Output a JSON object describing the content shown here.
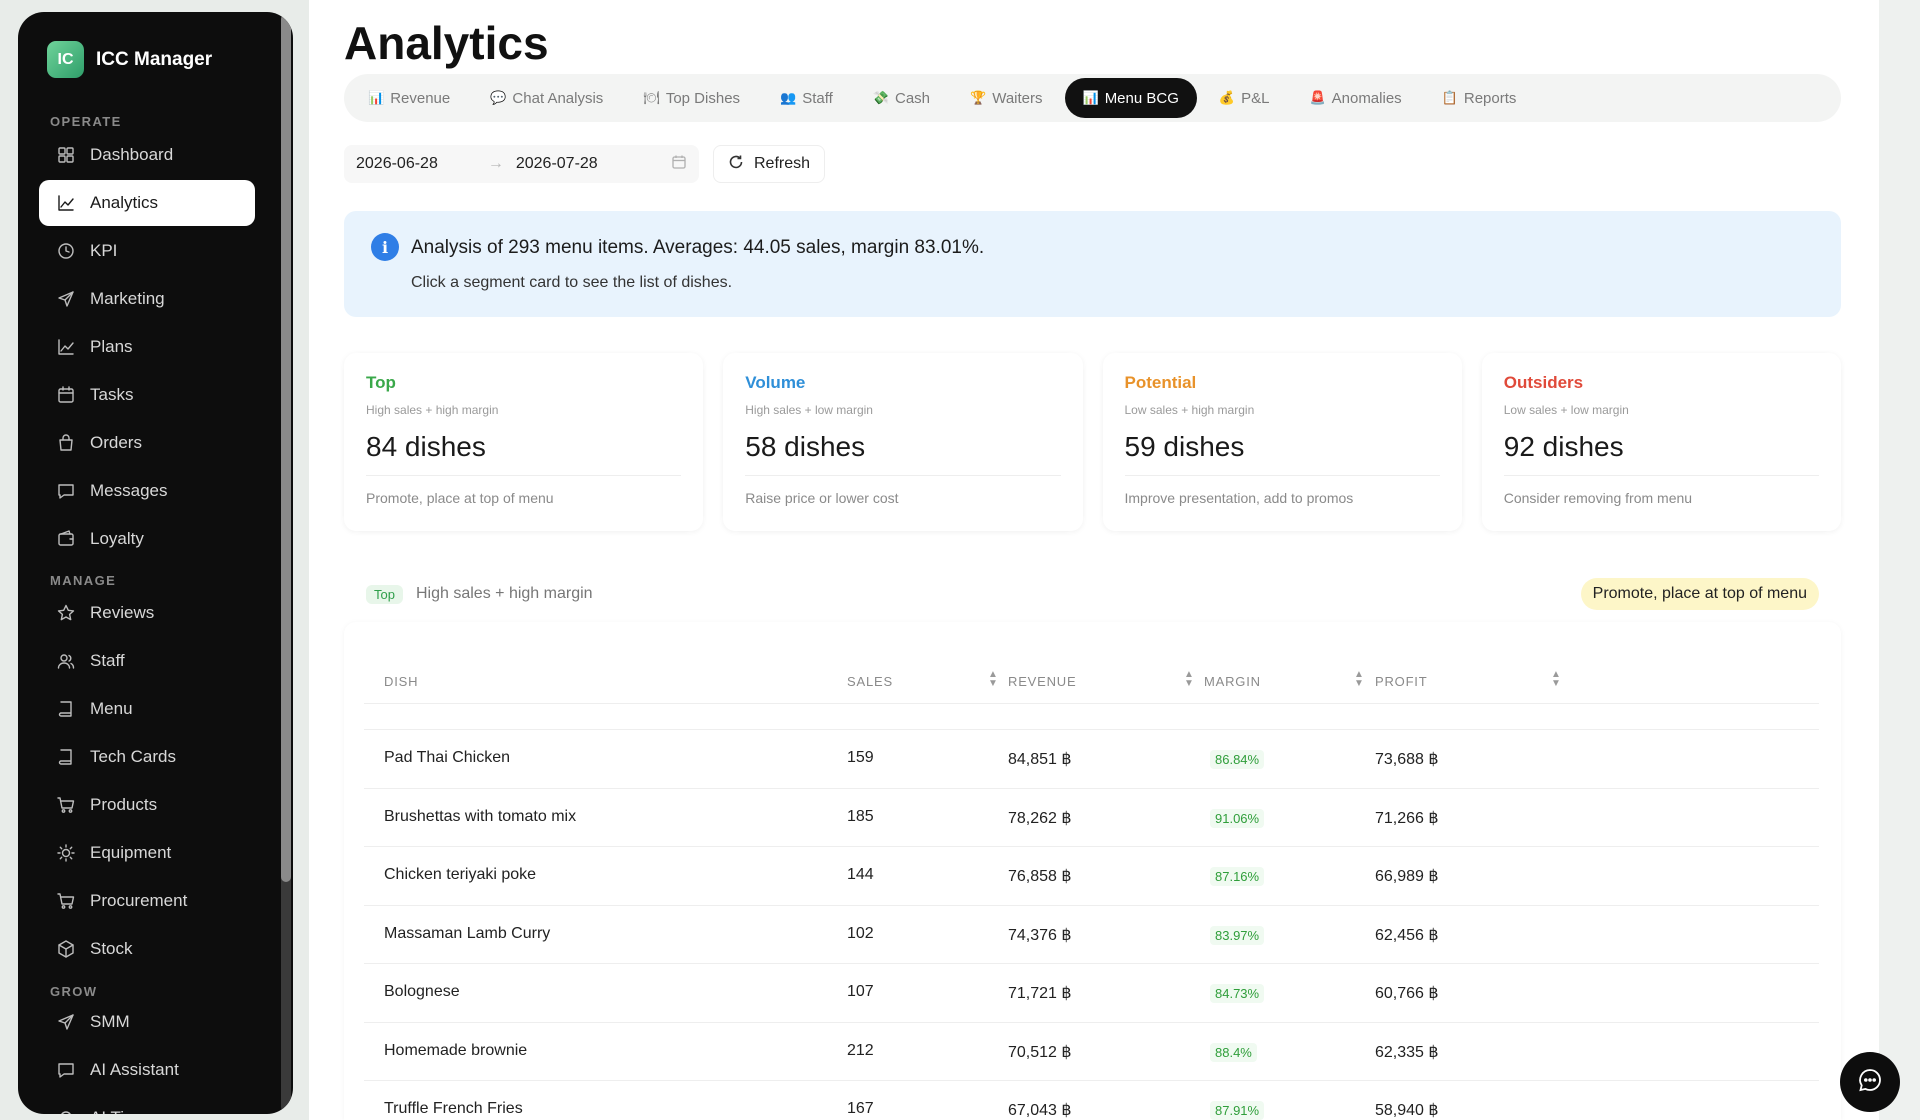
{
  "brand": {
    "name": "ICC Manager",
    "logo": "IC"
  },
  "sidebar": {
    "sections": [
      {
        "label": "OPERATE"
      },
      {
        "label": "MANAGE"
      },
      {
        "label": "GROW"
      }
    ],
    "items": [
      {
        "label": "Dashboard",
        "icon": "grid-icon"
      },
      {
        "label": "Analytics",
        "icon": "chart-line-icon",
        "active": true
      },
      {
        "label": "KPI",
        "icon": "clock-icon"
      },
      {
        "label": "Marketing",
        "icon": "send-icon"
      },
      {
        "label": "Plans",
        "icon": "chart-line-icon"
      },
      {
        "label": "Tasks",
        "icon": "calendar-icon"
      },
      {
        "label": "Orders",
        "icon": "bag-icon"
      },
      {
        "label": "Messages",
        "icon": "message-icon"
      },
      {
        "label": "Loyalty",
        "icon": "wallet-icon"
      },
      {
        "label": "Reviews",
        "icon": "star-icon"
      },
      {
        "label": "Staff",
        "icon": "users-icon"
      },
      {
        "label": "Menu",
        "icon": "book-icon"
      },
      {
        "label": "Tech Cards",
        "icon": "book-icon"
      },
      {
        "label": "Products",
        "icon": "cart-icon"
      },
      {
        "label": "Equipment",
        "icon": "sun-icon"
      },
      {
        "label": "Procurement",
        "icon": "cart-icon"
      },
      {
        "label": "Stock",
        "icon": "box-icon"
      },
      {
        "label": "SMM",
        "icon": "send-icon"
      },
      {
        "label": "AI Assistant",
        "icon": "message-icon"
      },
      {
        "label": "AI Tips",
        "icon": "bulb-icon"
      }
    ]
  },
  "page": {
    "title": "Analytics"
  },
  "tabs": [
    {
      "label": "Revenue",
      "emoji": "📊"
    },
    {
      "label": "Chat Analysis",
      "emoji": "💬"
    },
    {
      "label": "Top Dishes",
      "emoji": "🍽"
    },
    {
      "label": "Staff",
      "emoji": "👥"
    },
    {
      "label": "Cash",
      "emoji": "💸"
    },
    {
      "label": "Waiters",
      "emoji": "🏆"
    },
    {
      "label": "Menu BCG",
      "emoji": "📊",
      "active": true
    },
    {
      "label": "P&L",
      "emoji": "💰"
    },
    {
      "label": "Anomalies",
      "emoji": "🚨"
    },
    {
      "label": "Reports",
      "emoji": "📋"
    }
  ],
  "filters": {
    "date_from": "2026-06-28",
    "date_to": "2026-07-28",
    "arrow": "→",
    "refresh_label": "Refresh"
  },
  "info": {
    "main": "Analysis of 293 menu items. Averages: 44.05 sales, margin 83.01%.",
    "sub": "Click a segment card to see the list of dishes."
  },
  "segments": [
    {
      "title": "Top",
      "desc": "High sales + high margin",
      "count": "84 dishes",
      "action": "Promote, place at top of menu",
      "color": "#3aa84a"
    },
    {
      "title": "Volume",
      "desc": "High sales + low margin",
      "count": "58 dishes",
      "action": "Raise price or lower cost",
      "color": "#2f8fd8"
    },
    {
      "title": "Potential",
      "desc": "Low sales + high margin",
      "count": "59 dishes",
      "action": "Improve presentation, add to promos",
      "color": "#e8922a"
    },
    {
      "title": "Outsiders",
      "desc": "Low sales + low margin",
      "count": "92 dishes",
      "action": "Consider removing from menu",
      "color": "#e04a3a"
    }
  ],
  "selected_segment": {
    "badge": "Top",
    "desc": "High sales + high margin",
    "action": "Promote, place at top of menu"
  },
  "table": {
    "columns": [
      "DISH",
      "SALES",
      "REVENUE",
      "MARGIN",
      "PROFIT"
    ],
    "rows": [
      {
        "dish": "Pad Thai Chicken",
        "sales": "159",
        "revenue": "84,851 ฿",
        "margin": "86.84%",
        "profit": "73,688 ฿"
      },
      {
        "dish": "Brushettas with tomato mix",
        "sales": "185",
        "revenue": "78,262 ฿",
        "margin": "91.06%",
        "profit": "71,266 ฿"
      },
      {
        "dish": "Chicken teriyaki poke",
        "sales": "144",
        "revenue": "76,858 ฿",
        "margin": "87.16%",
        "profit": "66,989 ฿"
      },
      {
        "dish": "Massaman Lamb Curry",
        "sales": "102",
        "revenue": "74,376 ฿",
        "margin": "83.97%",
        "profit": "62,456 ฿"
      },
      {
        "dish": "Bolognese",
        "sales": "107",
        "revenue": "71,721 ฿",
        "margin": "84.73%",
        "profit": "60,766 ฿"
      },
      {
        "dish": "Homemade brownie",
        "sales": "212",
        "revenue": "70,512 ฿",
        "margin": "88.4%",
        "profit": "62,335 ฿"
      },
      {
        "dish": "Truffle French Fries",
        "sales": "167",
        "revenue": "67,043 ฿",
        "margin": "87.91%",
        "profit": "58,940 ฿"
      }
    ]
  }
}
